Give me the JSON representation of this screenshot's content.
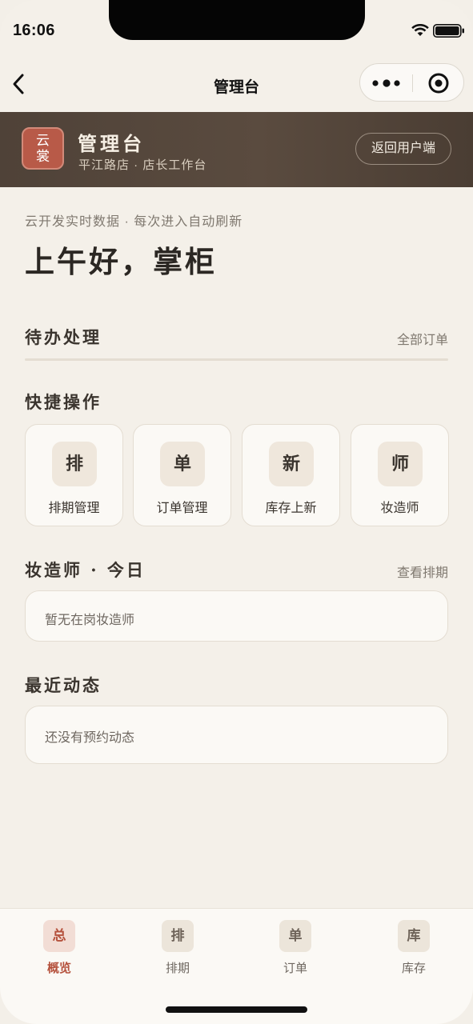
{
  "status": {
    "time": "16:06"
  },
  "nav": {
    "title": "管理台"
  },
  "header": {
    "logo_line1": "云",
    "logo_line2": "裳",
    "title": "管理台",
    "subtitle": "平江路店 · 店长工作台",
    "return_label": "返回用户端"
  },
  "main": {
    "subtitle": "云开发实时数据 · 每次进入自动刷新",
    "greeting": "上午好，掌柜",
    "todo": {
      "title": "待办处理",
      "link": "全部订单"
    },
    "quick": {
      "title": "快捷操作",
      "items": [
        {
          "icon": "排",
          "label": "排期管理"
        },
        {
          "icon": "单",
          "label": "订单管理"
        },
        {
          "icon": "新",
          "label": "库存上新"
        },
        {
          "icon": "师",
          "label": "妆造师"
        }
      ]
    },
    "artists": {
      "title": "妆造师 · 今日",
      "link": "查看排期",
      "empty": "暂无在岗妆造师"
    },
    "activity": {
      "title": "最近动态",
      "empty": "还没有预约动态"
    }
  },
  "tabbar": {
    "active_color": "#b5523d",
    "items": [
      {
        "icon": "总",
        "label": "概览",
        "active": true
      },
      {
        "icon": "排",
        "label": "排期",
        "active": false
      },
      {
        "icon": "单",
        "label": "订单",
        "active": false
      },
      {
        "icon": "库",
        "label": "库存",
        "active": false
      }
    ]
  }
}
